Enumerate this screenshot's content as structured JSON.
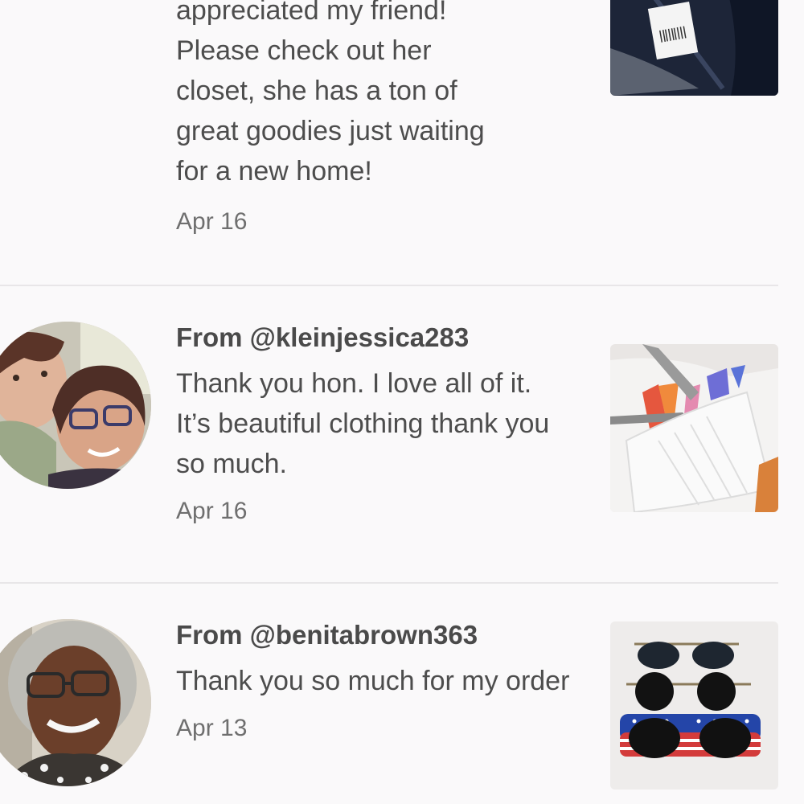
{
  "notes": [
    {
      "message_lines": [
        "appreciated my friend!",
        "Please check out her",
        "closet, she has a ton of",
        "great goodies just waiting",
        "for a new home!"
      ],
      "date": "Apr 16",
      "thumbnail": "navy-garment-with-tag"
    },
    {
      "from": "From @kleinjessica283",
      "message": "Thank you hon. I love all of it. It’s beautiful clothing thank you so much.",
      "date": "Apr 16",
      "avatar": "two-women-selfie",
      "thumbnail": "white-pink-shirt"
    },
    {
      "from": "From @benitabrown363",
      "message": "Thank you so much for my order",
      "date": "Apr 13",
      "avatar": "woman-with-glasses",
      "thumbnail": "three-pairs-sunglasses"
    }
  ]
}
